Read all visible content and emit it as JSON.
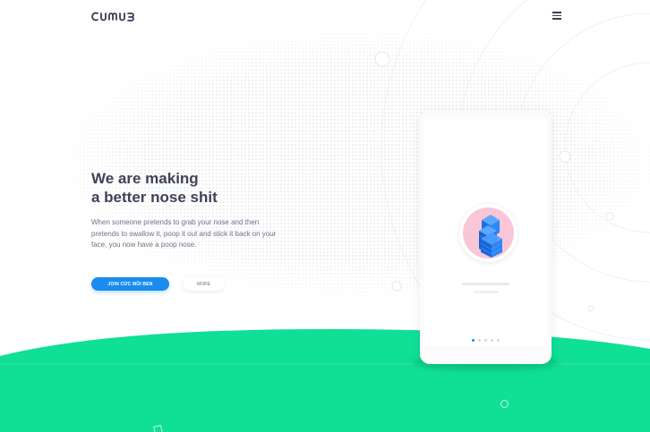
{
  "header": {
    "logo_text": "cumb",
    "menu_icon": "hamburger-icon"
  },
  "hero": {
    "headline_line1": "We are making",
    "headline_line2": "a better nose shit",
    "description": "When someone pretends to grab your nose and then pretends to swallow it, poop it out and stick it back on your face, you now have a poop nose.",
    "primary_button": "JOIN CỨC MŨI BEN",
    "secondary_button": "MORE"
  },
  "phone": {
    "avatar_icon": "building-icon",
    "carousel": {
      "count": 5,
      "active_index": 0
    }
  },
  "colors": {
    "accent_blue": "#1a8cf0",
    "green": "#10df96",
    "pink": "#f8c6d7",
    "text_dark": "#3f4257",
    "text_muted": "#6f7385"
  }
}
